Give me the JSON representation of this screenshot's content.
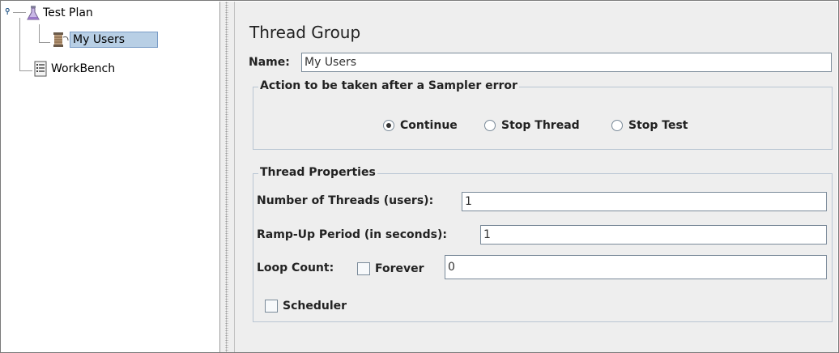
{
  "tree": {
    "items": [
      {
        "label": "Test Plan"
      },
      {
        "label": "My Users"
      },
      {
        "label": "WorkBench"
      }
    ]
  },
  "panel": {
    "title": "Thread Group",
    "name_label": "Name:",
    "name_value": "My Users",
    "error_group": {
      "legend": "Action to be taken after a Sampler error",
      "options": [
        {
          "label": "Continue",
          "selected": true
        },
        {
          "label": "Stop Thread",
          "selected": false
        },
        {
          "label": "Stop Test",
          "selected": false
        }
      ]
    },
    "thread_props": {
      "legend": "Thread Properties",
      "threads_label": "Number of Threads (users):",
      "threads_value": "1",
      "rampup_label": "Ramp-Up Period (in seconds):",
      "rampup_value": "1",
      "loop_label": "Loop Count:",
      "forever_label": "Forever",
      "forever_checked": false,
      "loop_value": "0",
      "scheduler_label": "Scheduler",
      "scheduler_checked": false
    }
  },
  "colors": {
    "selection": "#b8cfe5",
    "panel_bg": "#eeeeee",
    "group_border": "#b9c6d3"
  }
}
